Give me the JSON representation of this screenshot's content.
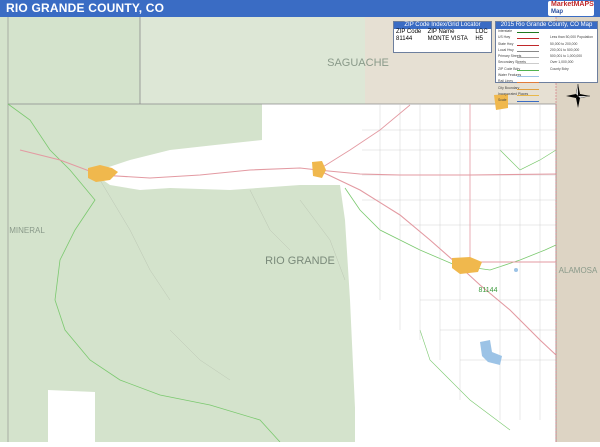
{
  "title": "RIO GRANDE COUNTY, CO",
  "brand": {
    "line1": "MarketMAPS",
    "line2": "Map"
  },
  "map_labels": {
    "saguache": "SAGUACHE",
    "rio_grande": "RIO GRANDE",
    "mineral": "MINERAL",
    "alamosa": "ALAMOSA",
    "zip_81144": "81144"
  },
  "zip_panel": {
    "header": "ZIP Code Index/Grid Locator",
    "columns": [
      "ZIP Code",
      "ZIP Name",
      "LOC"
    ],
    "rows": [
      [
        "81144",
        "MONTE VISTA",
        "H5"
      ]
    ]
  },
  "legend": {
    "header": "2015 Rio Grande County, CO Map",
    "rows": [
      {
        "label": "Interstate",
        "color": "#1f7a1f",
        "right": ""
      },
      {
        "label": "US Hwy",
        "color": "#c0282a",
        "right": "Less than 50,000 Population"
      },
      {
        "label": "State Hwy",
        "color": "#c0282a",
        "right": "50,000 to 200,000"
      },
      {
        "label": "Local Hwy",
        "color": "#888888",
        "right": "200,001 to 500,000"
      },
      {
        "label": "Primary Streets",
        "color": "#aaaaaa",
        "right": "500,001 to 1,000,000"
      },
      {
        "label": "Secondary Streets",
        "color": "#cccccc",
        "right": "Over 1,000,000"
      },
      {
        "label": "ZIP Code Bdry",
        "color": "#4fb34f",
        "right": "County Bdry"
      },
      {
        "label": "Water Features",
        "color": "#9cc3e6",
        "right": ""
      },
      {
        "label": "Rail Lines",
        "color": "#e07b3a",
        "right": ""
      },
      {
        "label": "City Boundary",
        "color": "#e0a040",
        "right": ""
      },
      {
        "label": "Incorporated Places",
        "color": "#e8b84a",
        "right": ""
      },
      {
        "label": "Scale",
        "color": "#3a6cc4",
        "right": ""
      }
    ]
  },
  "compass": {
    "north": "N",
    "south": "S",
    "east": "E",
    "west": "W"
  },
  "colors": {
    "forest": "#d4e3cc",
    "forest_dark": "#c9dcbf",
    "county_outside": "#e3dfd6",
    "outside_east": "#ddd4c4",
    "water": "#9cc3e6",
    "city": "#f0b84d",
    "zip_boundary": "#7bc96f",
    "road_major": "#d8707a"
  }
}
